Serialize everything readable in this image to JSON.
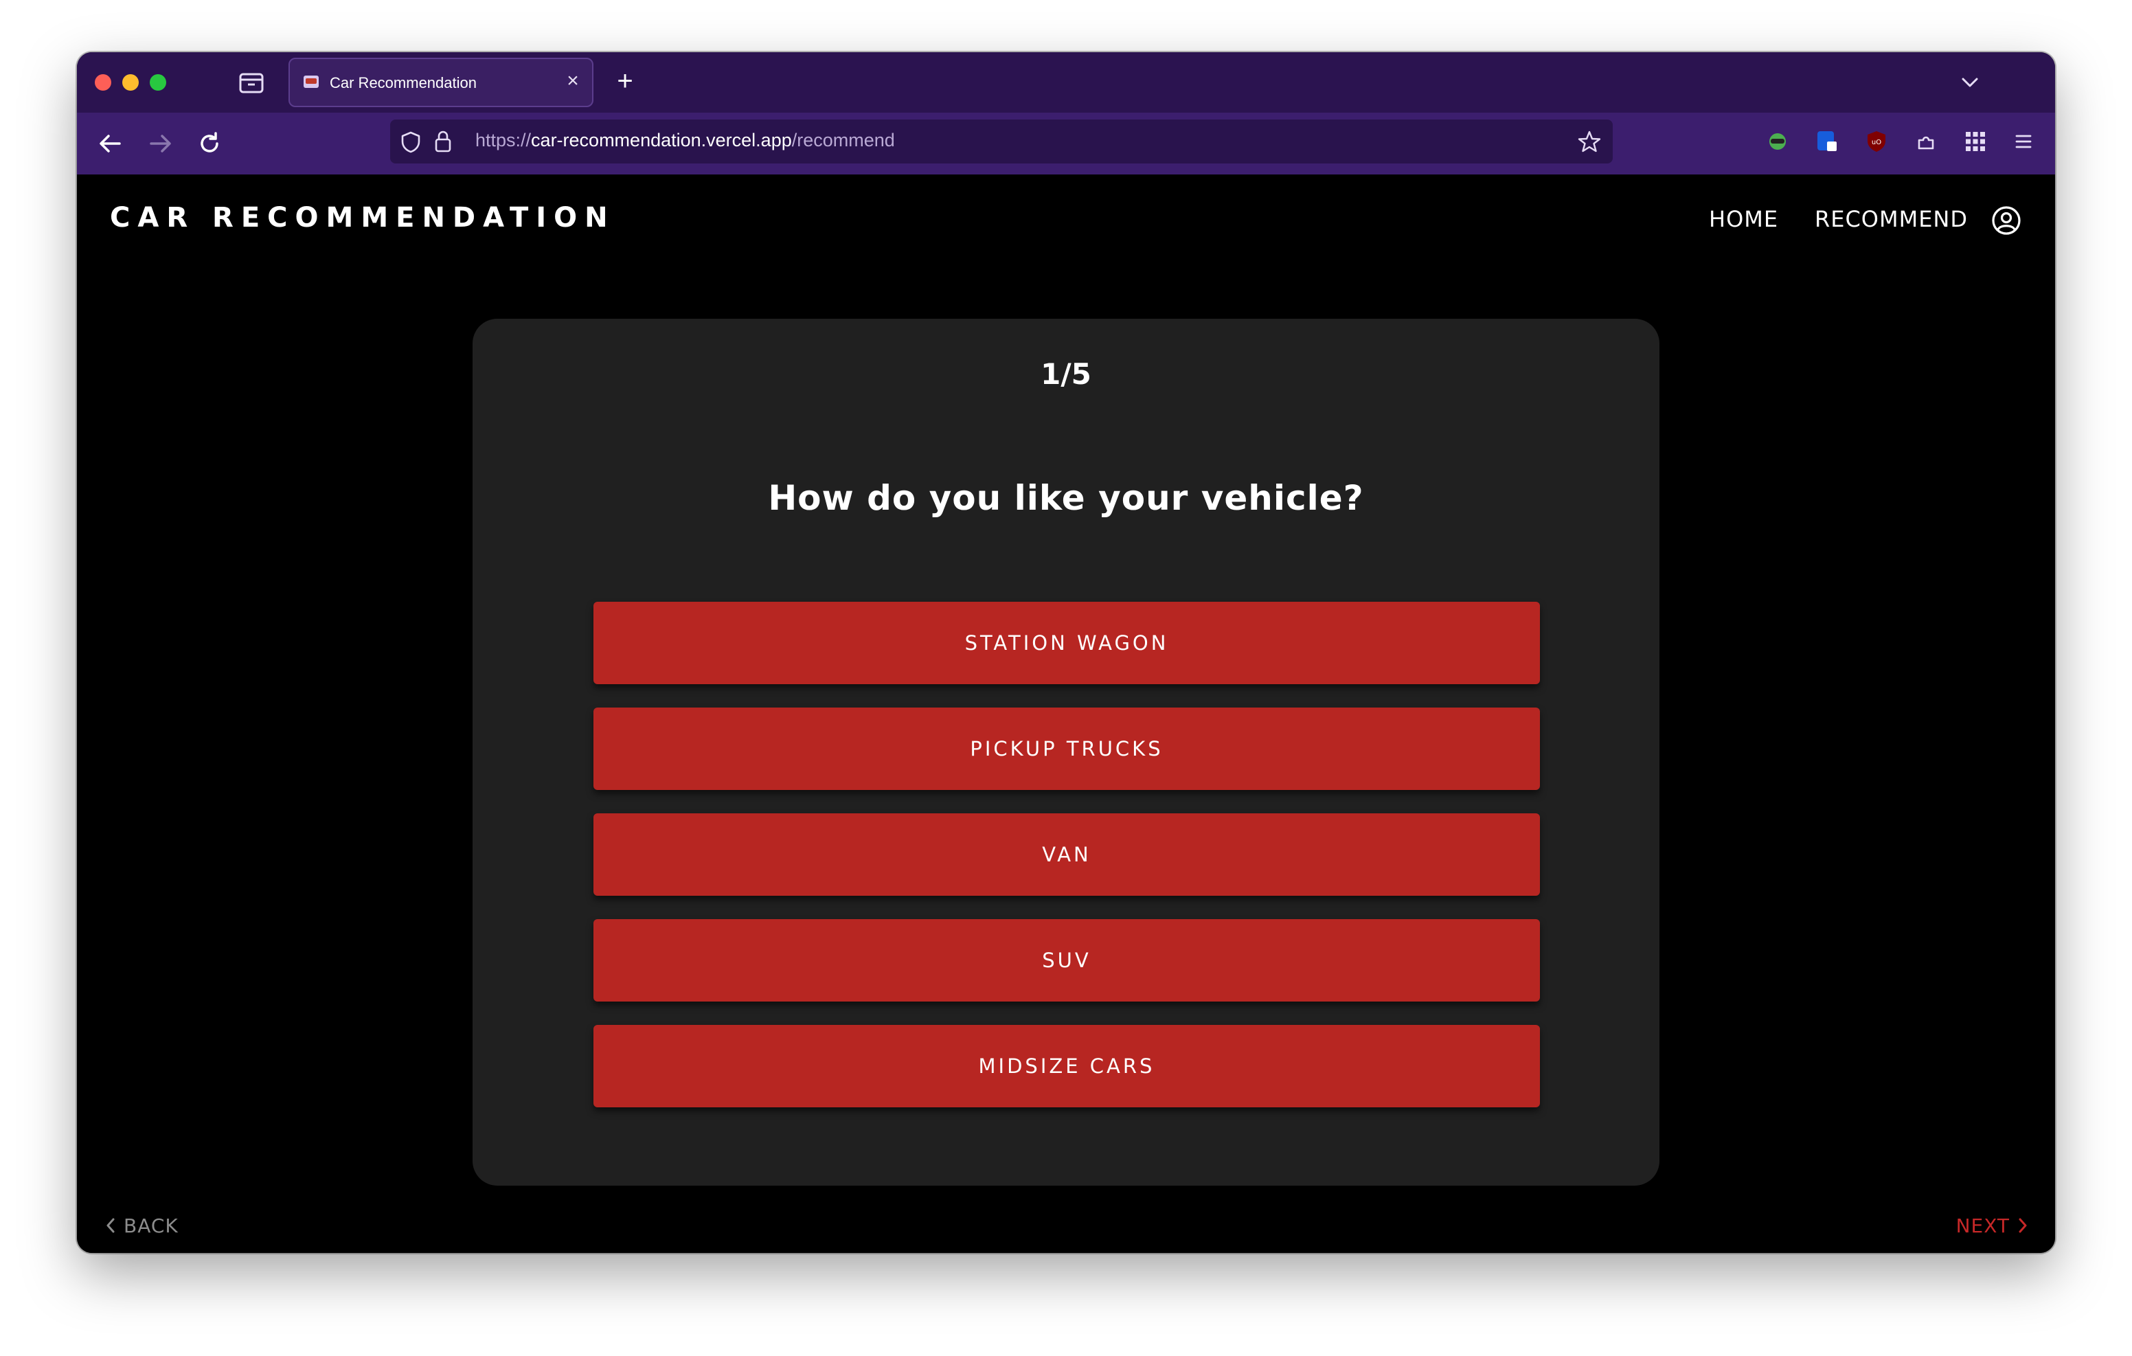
{
  "browser": {
    "tab_title": "Car Recommendation",
    "url_prefix": "https://",
    "url_host": "car-recommendation.vercel.app",
    "url_path": "/recommend",
    "icons": [
      "tab-overview-icon",
      "close-icon",
      "plus-icon",
      "chevron-down-icon",
      "back-arrow-icon",
      "forward-arrow-icon",
      "reload-icon",
      "shield-icon",
      "lock-icon",
      "star-icon",
      "extension-icon",
      "menu-icon"
    ]
  },
  "header": {
    "brand": "CAR RECOMMENDATION",
    "nav": [
      {
        "label": "HOME"
      },
      {
        "label": "RECOMMEND"
      }
    ]
  },
  "quiz": {
    "step": "1/5",
    "question": "How do you like your vehicle?",
    "options": [
      {
        "label": "STATION WAGON"
      },
      {
        "label": "PICKUP TRUCKS"
      },
      {
        "label": "VAN"
      },
      {
        "label": "SUV"
      },
      {
        "label": "MIDSIZE CARS"
      }
    ]
  },
  "footer": {
    "back_label": "BACK",
    "next_label": "NEXT",
    "progress_fraction": 0.2
  },
  "colors": {
    "accent": "#b72622",
    "card": "#202020",
    "browser_chrome": "#3c1e6e"
  }
}
